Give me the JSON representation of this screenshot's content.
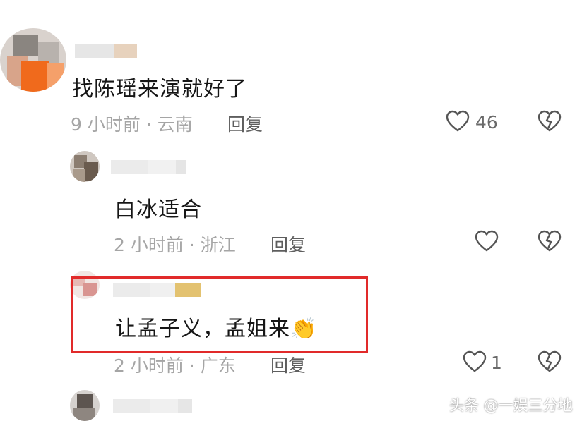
{
  "colors": {
    "highlight_border": "#e12a2a",
    "meta_text": "#a5a5a5",
    "icon_stroke": "#555555"
  },
  "comments": [
    {
      "text": "找陈瑶来演就好了",
      "meta": "9 小时前 · 云南",
      "reply": "回复",
      "likes": "46",
      "like_icon": "heart-outline-icon",
      "dislike_icon": "broken-heart-icon"
    },
    {
      "text": "白冰适合",
      "meta": "2 小时前 · 浙江",
      "reply": "回复",
      "likes": "",
      "like_icon": "heart-outline-icon",
      "dislike_icon": "broken-heart-icon"
    },
    {
      "text": "让孟子义，孟姐来",
      "emoji": "👏",
      "meta": "2 小时前 · 广东",
      "reply": "回复",
      "likes": "1",
      "like_icon": "heart-outline-icon",
      "dislike_icon": "broken-heart-icon"
    }
  ],
  "watermark": {
    "text": "头条 @一娱三分地"
  }
}
